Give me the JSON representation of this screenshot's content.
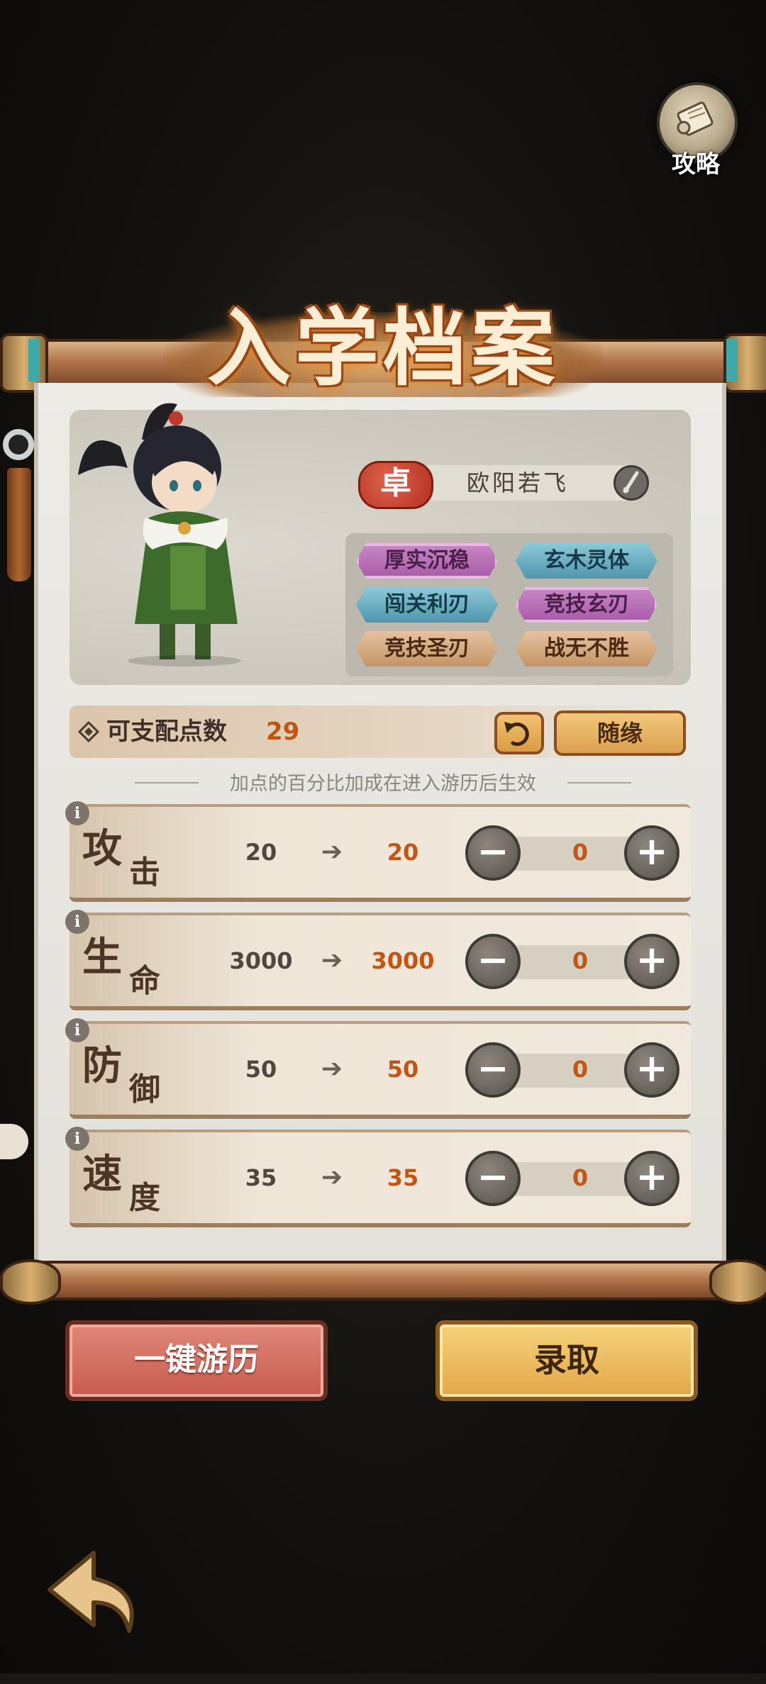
{
  "guide": {
    "label": "攻略",
    "icon": "scroll-icon"
  },
  "title": "入学档案",
  "character": {
    "surname_badge": "卓",
    "name": "欧阳若飞",
    "rename_icon": "brush-icon",
    "traits": [
      {
        "label": "厚实沉稳",
        "color": "pink"
      },
      {
        "label": "玄木灵体",
        "color": "blue"
      },
      {
        "label": "闯关利刃",
        "color": "blue"
      },
      {
        "label": "竞技玄刃",
        "color": "pink"
      },
      {
        "label": "竞技圣刃",
        "color": "brown"
      },
      {
        "label": "战无不胜",
        "color": "brown"
      }
    ]
  },
  "points": {
    "label": "可支配点数",
    "value": "29",
    "reset_icon": "undo-icon",
    "random_label": "随缘"
  },
  "hint": "加点的百分比加成在进入游历后生效",
  "stats": [
    {
      "name_1": "攻",
      "name_2": "击",
      "base": "20",
      "new": "20",
      "added": "0"
    },
    {
      "name_1": "生",
      "name_2": "命",
      "base": "3000",
      "new": "3000",
      "added": "0"
    },
    {
      "name_1": "防",
      "name_2": "御",
      "base": "50",
      "new": "50",
      "added": "0"
    },
    {
      "name_1": "速",
      "name_2": "度",
      "base": "35",
      "new": "35",
      "added": "0"
    }
  ],
  "stat_controls": {
    "info": "i",
    "minus": "−",
    "plus": "+",
    "arrow": "➔"
  },
  "buttons": {
    "tour": "一键游历",
    "admit": "录取"
  },
  "colors": {
    "accent": "#c25614",
    "tour_button": "#c65b4d",
    "admit_button": "#e2a747"
  }
}
